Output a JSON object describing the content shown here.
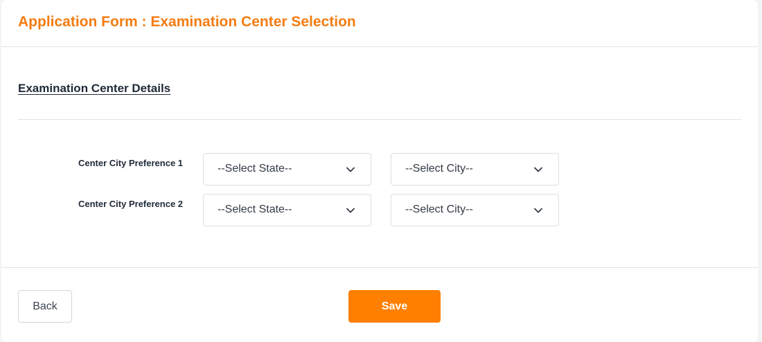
{
  "form": {
    "title": "Application Form : Examination Center Selection",
    "section_title": "Examination Center Details"
  },
  "preferences": [
    {
      "label": "Center City Preference 1",
      "state_select": {
        "value": "--Select State--"
      },
      "city_select": {
        "value": "--Select City--"
      }
    },
    {
      "label": "Center City Preference 2",
      "state_select": {
        "value": "--Select State--"
      },
      "city_select": {
        "value": "--Select City--"
      }
    }
  ],
  "actions": {
    "back_label": "Back",
    "save_label": "Save"
  },
  "icons": {
    "dropdown": "chevron-down-icon"
  },
  "colors": {
    "accent": "#ff7f00",
    "title": "#f47c11",
    "text": "#1f2a37"
  }
}
